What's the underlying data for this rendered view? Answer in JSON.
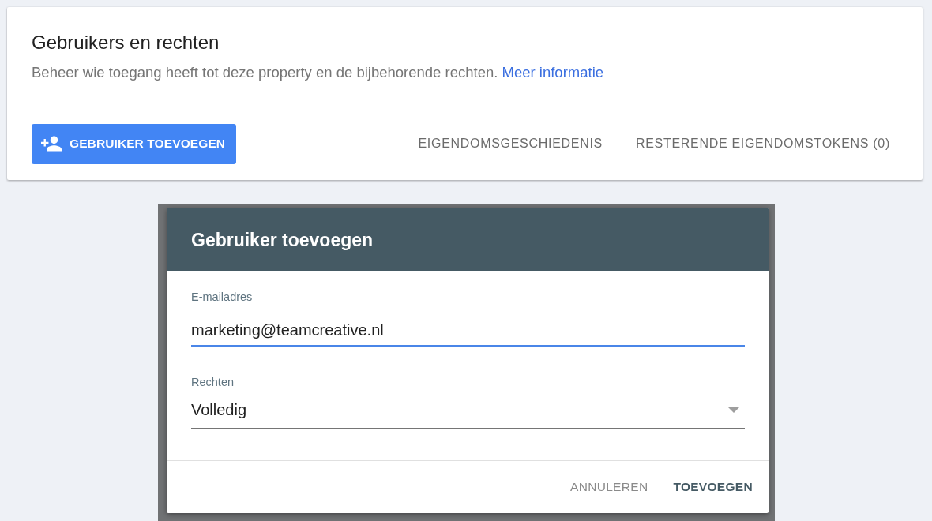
{
  "header": {
    "title": "Gebruikers en rechten",
    "description": "Beheer wie toegang heeft tot deze property en de bijbehorende rechten.",
    "link": "Meer informatie"
  },
  "actions": {
    "primary": "GEBRUIKER TOEVOEGEN",
    "secondary": [
      "EIGENDOMSGESCHIEDENIS",
      "RESTERENDE EIGENDOMSTOKENS (0)"
    ]
  },
  "dialog": {
    "title": "Gebruiker toevoegen",
    "fields": [
      {
        "kind": "text",
        "label": "E-mailadres",
        "value": "marketing@teamcreative.nl",
        "focused": true
      },
      {
        "kind": "select",
        "label": "Rechten",
        "value": "Volledig",
        "focused": false
      }
    ],
    "buttons": [
      {
        "label": "ANNULEREN",
        "primary": false
      },
      {
        "label": "TOEVOEGEN",
        "primary": true
      }
    ]
  }
}
